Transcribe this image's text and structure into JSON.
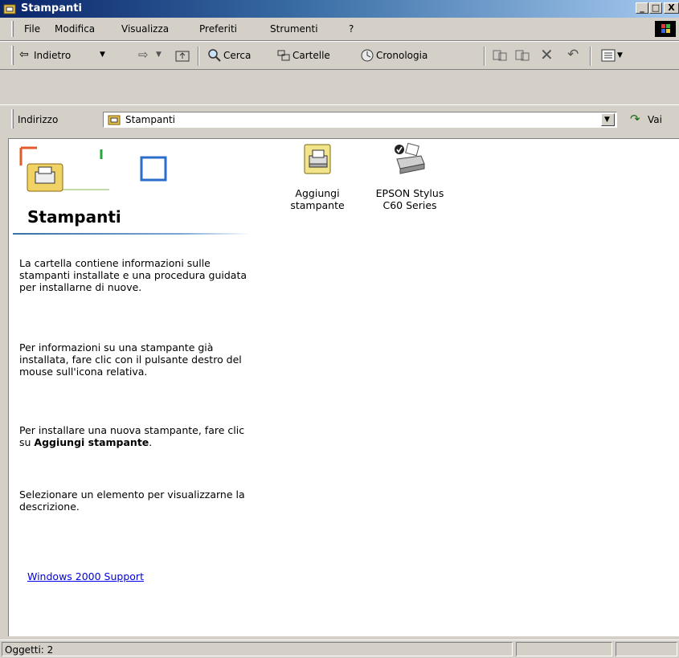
{
  "window": {
    "title": "Stampanti"
  },
  "menu": {
    "items": [
      {
        "label": "File"
      },
      {
        "label": "Modifica"
      },
      {
        "label": "Visualizza"
      },
      {
        "label": "Preferiti"
      },
      {
        "label": "Strumenti"
      },
      {
        "label": "?"
      }
    ]
  },
  "toolbar": {
    "back_label": "Indietro",
    "search_label": "Cerca",
    "folders_label": "Cartelle",
    "history_label": "Cronologia"
  },
  "address": {
    "label": "Indirizzo",
    "value": "Stampanti",
    "go_label": "Vai"
  },
  "left_panel": {
    "title": "Stampanti",
    "para1": "La cartella contiene informazioni sulle stampanti installate e una procedura guidata per installarne di nuove.",
    "para2": "Per informazioni su una stampante già installata, fare clic con il pulsante destro del mouse sull'icona relativa.",
    "para3_prefix": "Per installare una nuova stampante, fare clic su ",
    "para3_bold": "Aggiungi stampante",
    "para3_suffix": ".",
    "para4": "Selezionare un elemento per visualizzarne la descrizione.",
    "link": "Windows 2000 Support"
  },
  "items": [
    {
      "line1": "Aggiungi",
      "line2": "stampante",
      "icon": "add-printer-icon"
    },
    {
      "line1": "EPSON Stylus",
      "line2": "C60 Series",
      "icon": "printer-icon"
    }
  ],
  "status": {
    "text": "Oggetti: 2"
  },
  "colors": {
    "titlebar_start": "#0a246a",
    "titlebar_end": "#a6caf0",
    "chrome": "#d4d0c8",
    "link": "#0000ee"
  }
}
